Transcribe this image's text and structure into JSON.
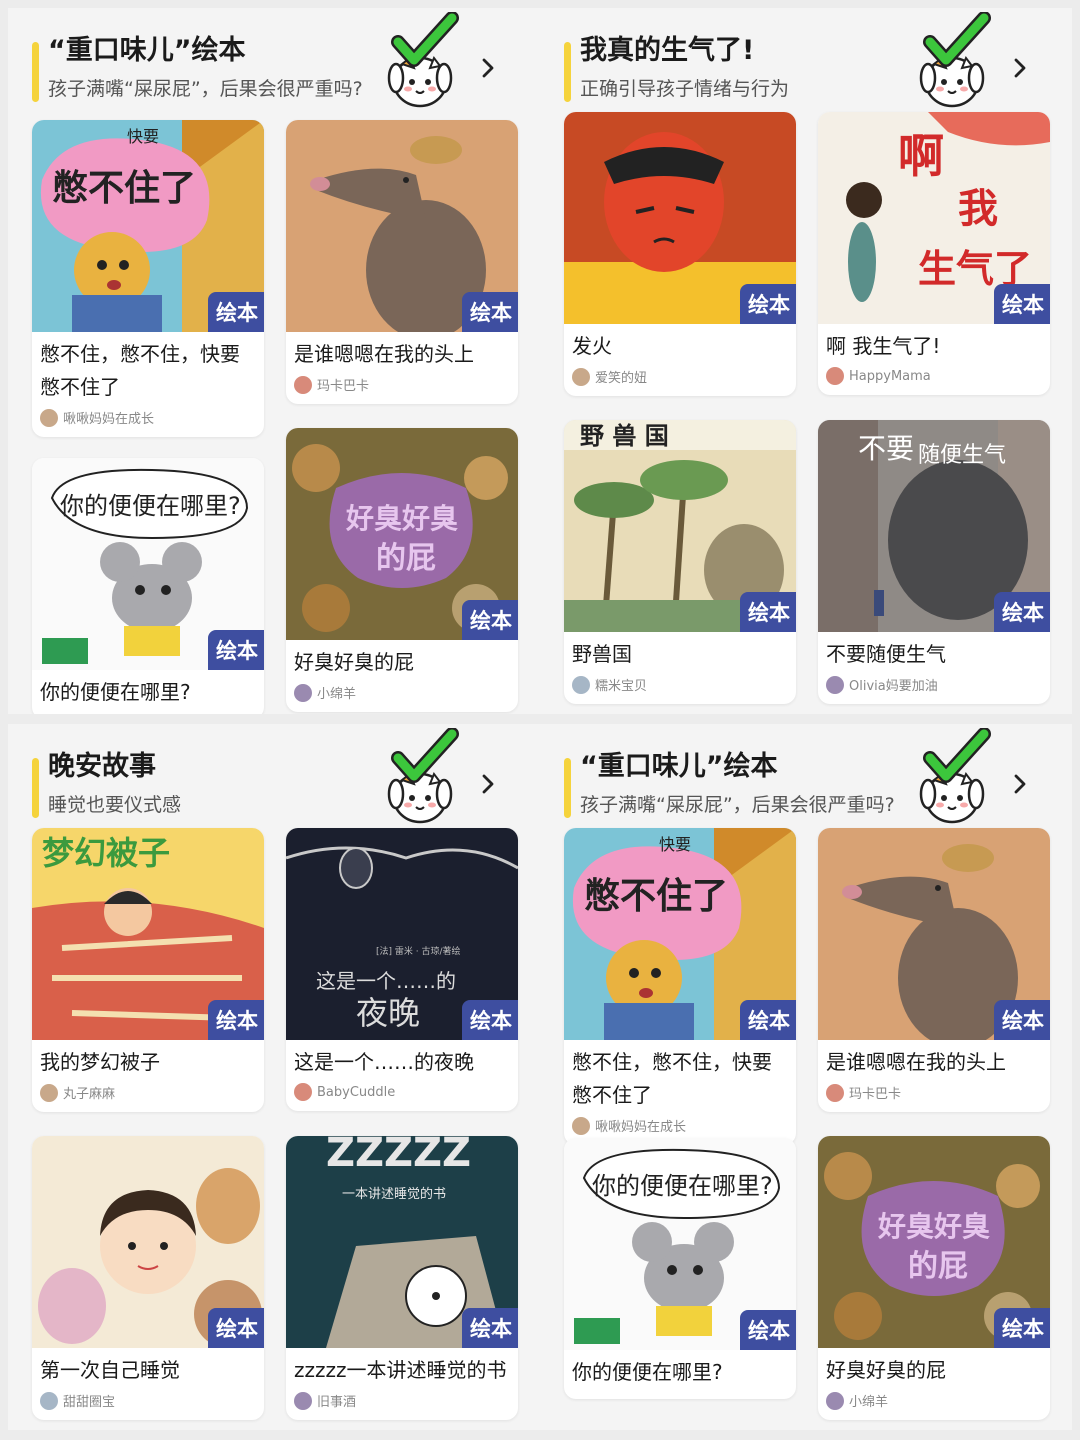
{
  "quadrants": [
    {
      "title": "“重口味儿”绘本",
      "subtitle": "孩子满嘴“屎尿屁”，后果会很严重吗?",
      "cards": [
        {
          "title": "憋不住，憋不住，快要憋不住了",
          "author": "啾啾妈妈在成长",
          "badge": "绘本",
          "cover_text": "快要 憋不住了"
        },
        {
          "title": "是谁嗯嗯在我的头上",
          "author": "玛卡巴卡",
          "badge": "绘本",
          "cover_text": ""
        },
        {
          "title": "你的便便在哪里?",
          "author": "",
          "badge": "绘本",
          "cover_text": "你的便便在哪里?"
        },
        {
          "title": "好臭好臭的屁",
          "author": "小绵羊",
          "badge": "绘本",
          "cover_text": "好臭好臭的屁"
        }
      ]
    },
    {
      "title": "我真的生气了!",
      "subtitle": "正确引导孩子情绪与行为",
      "cards": [
        {
          "title": "发火",
          "author": "爱笑的妞",
          "badge": "绘本",
          "cover_text": "发火"
        },
        {
          "title": "啊 我生气了!",
          "author": "HappyMama",
          "badge": "绘本",
          "cover_text": "啊 我 生气了"
        },
        {
          "title": "野兽国",
          "author": "糯米宝贝",
          "badge": "绘本",
          "cover_text": "野兽国"
        },
        {
          "title": "不要随便生气",
          "author": "Olivia妈要加油",
          "badge": "绘本",
          "cover_text": "不要 随便生气"
        }
      ]
    },
    {
      "title": "晚安故事",
      "subtitle": "睡觉也要仪式感",
      "cards": [
        {
          "title": "我的梦幻被子",
          "author": "丸子麻麻",
          "badge": "绘本",
          "cover_text": "梦幻被子"
        },
        {
          "title": "这是一个……的夜晚",
          "author": "BabyCuddle",
          "badge": "绘本",
          "cover_text": "这是一个……的 夜晚"
        },
        {
          "title": "第一次自己睡觉",
          "author": "甜甜圈宝",
          "badge": "绘本",
          "cover_text": ""
        },
        {
          "title": "zzzzz一本讲述睡觉的书",
          "author": "旧事酒",
          "badge": "绘本",
          "cover_text": "ZZZZZ 一本讲述睡觉的书"
        }
      ]
    },
    {
      "title": "“重口味儿”绘本",
      "subtitle": "孩子满嘴“屎尿屁”，后果会很严重吗?",
      "cards": [
        {
          "title": "憋不住，憋不住，快要憋不住了",
          "author": "啾啾妈妈在成长",
          "badge": "绘本",
          "cover_text": "快要 憋不住了"
        },
        {
          "title": "是谁嗯嗯在我的头上",
          "author": "玛卡巴卡",
          "badge": "绘本",
          "cover_text": ""
        },
        {
          "title": "你的便便在哪里?",
          "author": "",
          "badge": "绘本",
          "cover_text": "你的便便在哪里?"
        },
        {
          "title": "好臭好臭的屁",
          "author": "小绵羊",
          "badge": "绘本",
          "cover_text": "好臭好臭的屁"
        }
      ]
    }
  ],
  "colors": {
    "accent": "#f5d33c",
    "badge": "#3e4ea0",
    "check": "#3cc63c"
  },
  "icons": {
    "arrow": "chevron-right-icon",
    "mascot": "cat-checkmark-icon"
  }
}
